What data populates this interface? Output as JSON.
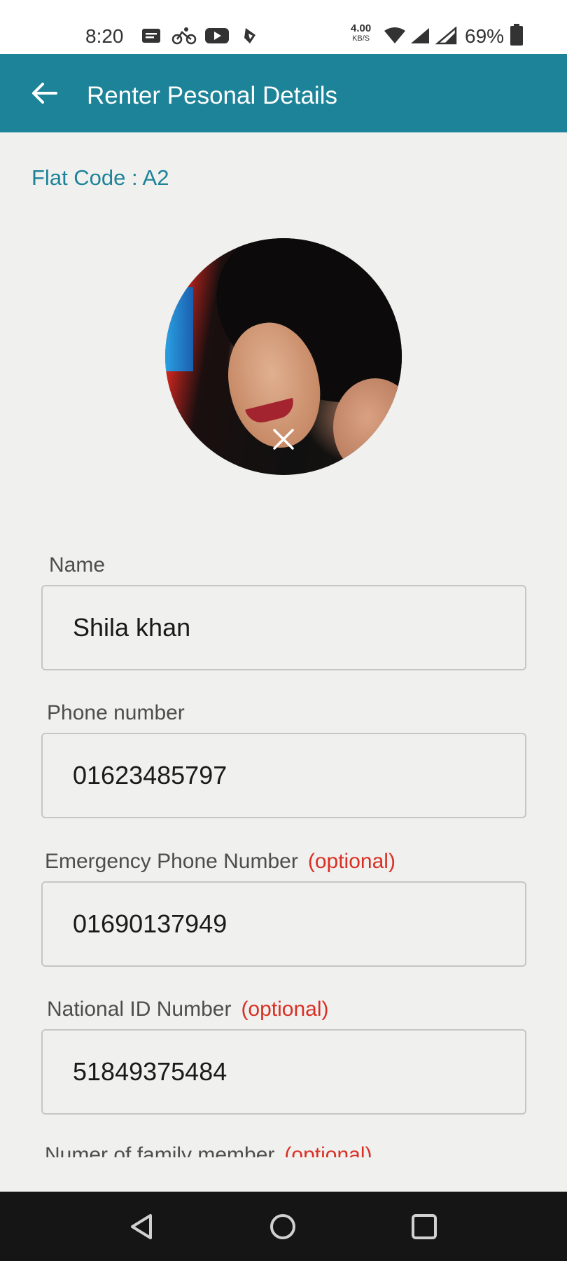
{
  "status_bar": {
    "time": "8:20",
    "speed_value": "4.00",
    "speed_unit": "KB/S",
    "battery": "69%"
  },
  "app_bar": {
    "title": "Renter Pesonal Details"
  },
  "flat_code": {
    "label": "Flat Code : ",
    "value": "A2"
  },
  "form": {
    "fields": [
      {
        "label": "Name",
        "optional": "",
        "value": "Shila khan"
      },
      {
        "label": "Phone number",
        "optional": "",
        "value": "01623485797"
      },
      {
        "label": "Emergency Phone Number",
        "optional": "(optional)",
        "value": "01690137949"
      },
      {
        "label": "National ID Number",
        "optional": "(optional)",
        "value": "51849375484"
      },
      {
        "label": "Numer of family member",
        "optional": "(optional)",
        "value": ""
      }
    ]
  },
  "colors": {
    "primary": "#1d8398",
    "optional_red": "#d93025",
    "background": "#f0f0ef"
  }
}
